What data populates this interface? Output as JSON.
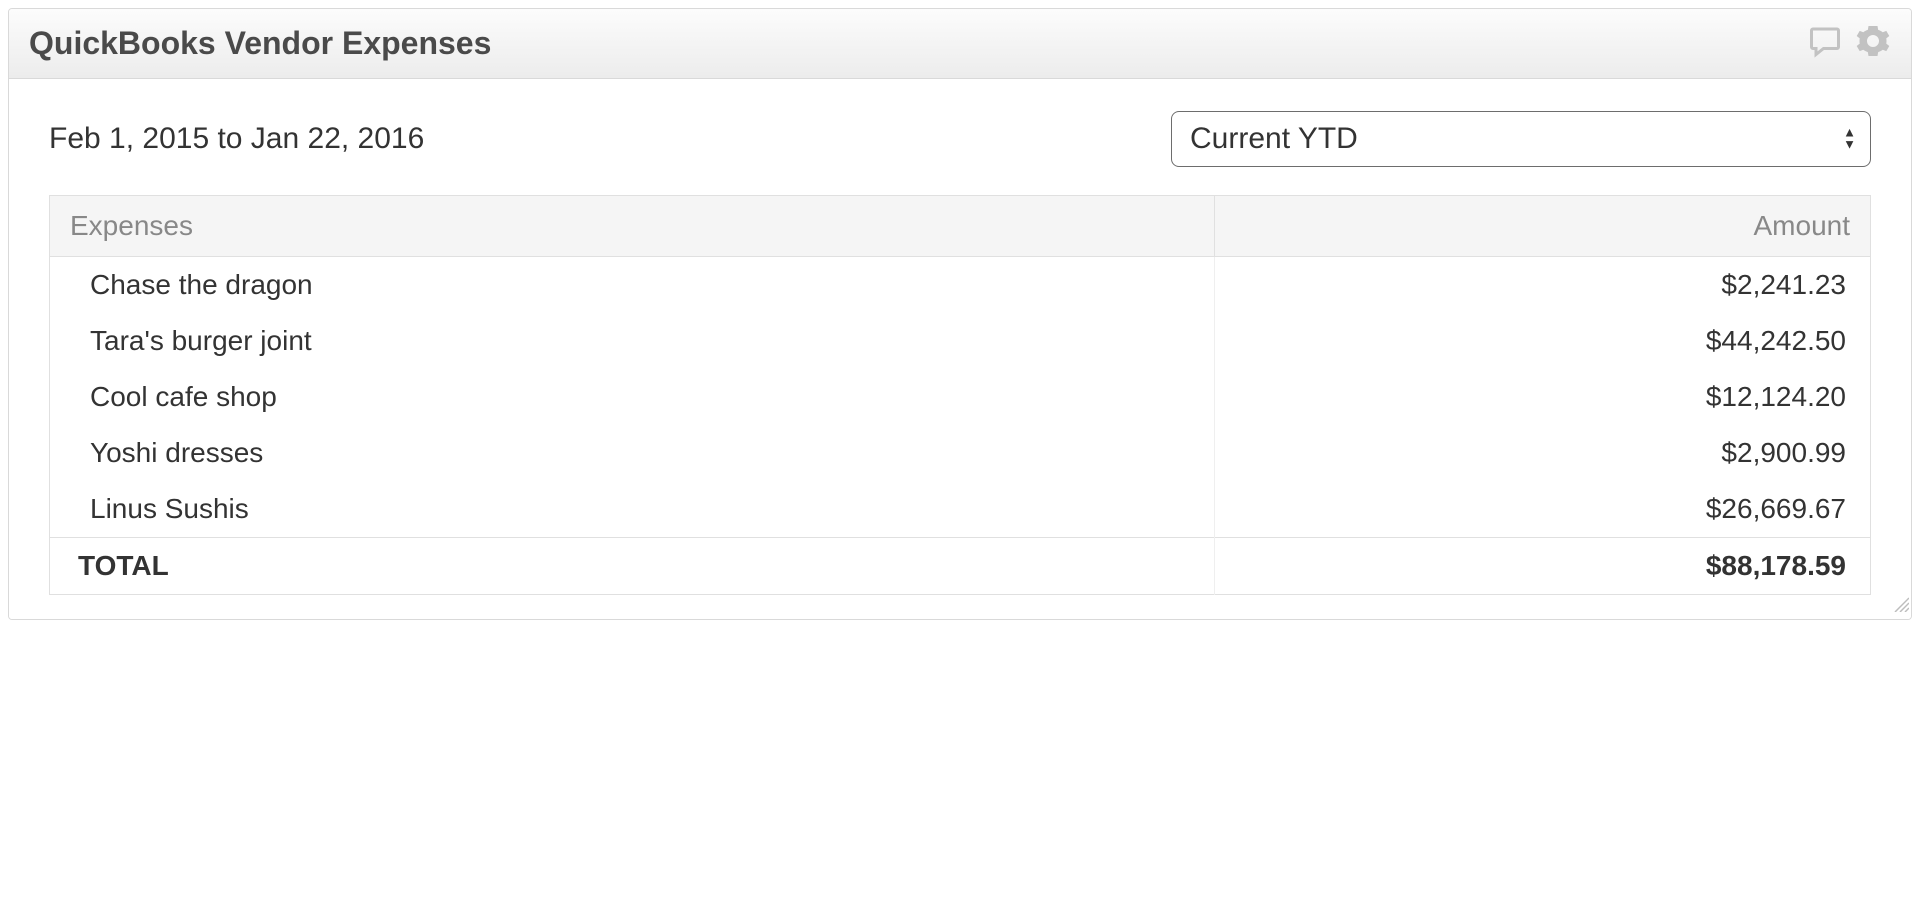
{
  "header": {
    "title": "QuickBooks Vendor Expenses"
  },
  "filter": {
    "date_range": "Feb 1, 2015 to Jan 22, 2016",
    "dropdown_value": "Current YTD"
  },
  "table": {
    "columns": {
      "expenses": "Expenses",
      "amount": "Amount"
    },
    "rows": [
      {
        "name": "Chase the dragon",
        "amount": "$2,241.23"
      },
      {
        "name": "Tara's burger joint",
        "amount": "$44,242.50"
      },
      {
        "name": "Cool cafe shop",
        "amount": "$12,124.20"
      },
      {
        "name": "Yoshi dresses",
        "amount": "$2,900.99"
      },
      {
        "name": "Linus Sushis",
        "amount": "$26,669.67"
      }
    ],
    "total": {
      "label": "TOTAL",
      "amount": "$88,178.59"
    }
  },
  "chart_data": {
    "type": "table",
    "title": "QuickBooks Vendor Expenses",
    "period": "Feb 1, 2015 to Jan 22, 2016",
    "columns": [
      "Expenses",
      "Amount"
    ],
    "rows": [
      [
        "Chase the dragon",
        2241.23
      ],
      [
        "Tara's burger joint",
        44242.5
      ],
      [
        "Cool cafe shop",
        12124.2
      ],
      [
        "Yoshi dresses",
        2900.99
      ],
      [
        "Linus Sushis",
        26669.67
      ]
    ],
    "total": 88178.59,
    "currency": "USD"
  }
}
